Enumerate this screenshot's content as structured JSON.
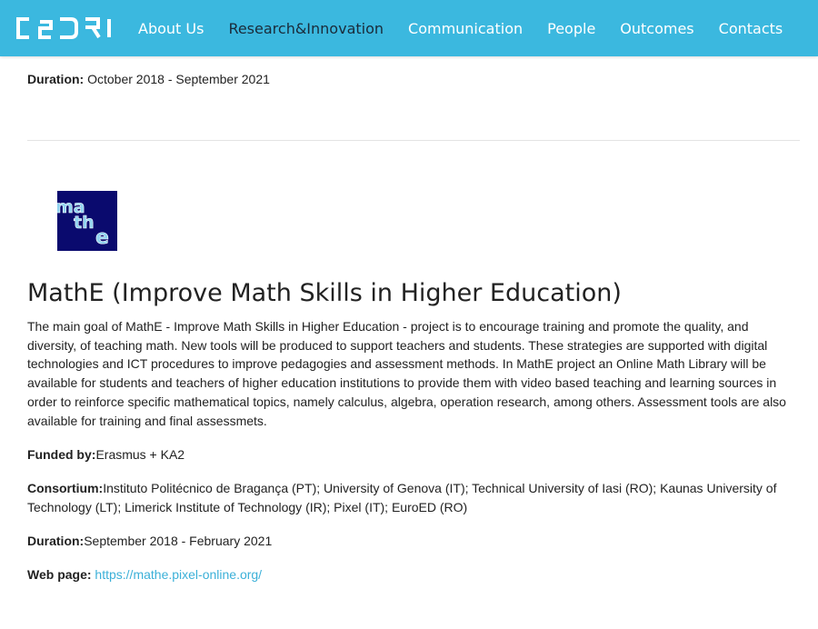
{
  "nav": {
    "logo_text": "CeDRI",
    "items": [
      {
        "label": "About Us",
        "active": false
      },
      {
        "label": "Research&Innovation",
        "active": true
      },
      {
        "label": "Communication",
        "active": false
      },
      {
        "label": "People",
        "active": false
      },
      {
        "label": "Outcomes",
        "active": false
      },
      {
        "label": "Contacts",
        "active": false
      }
    ],
    "bar_color": "#3bb8df"
  },
  "previous_project": {
    "duration_label": "Duration:",
    "duration_value": " October 2018 - September 2021"
  },
  "project": {
    "logo_text": "mathe",
    "title": "MathE (Improve Math Skills in Higher Education)",
    "description": "The main goal of MathE - Improve Math Skills in Higher Education - project is to encourage training and promote the quality, and diversity, of teaching math. New tools will be produced to support teachers and students. These strategies are supported with digital technologies and ICT procedures to improve pedagogies and assessment methods. In MathE project an Online Math Library will be available for students and teachers of higher education institutions to provide them with video based teaching and learning sources in order to reinforce specific mathematical topics, namely calculus, algebra, operation research, among others. Assessment tools are also available for training and final assessmets.",
    "funded_label": "Funded by:",
    "funded_value": "Erasmus + KA2",
    "consortium_label": "Consortium:",
    "consortium_value": "Instituto Politécnico de Bragança (PT); University of Genova (IT); Technical University of Iasi (RO); Kaunas University of Technology (LT); Limerick Institute of Technology (IR); Pixel (IT); EuroED (RO)",
    "duration_label": "Duration:",
    "duration_value": "September 2018 - February 2021",
    "webpage_label": "Web page:",
    "webpage_url": "https://mathe.pixel-online.org/"
  }
}
